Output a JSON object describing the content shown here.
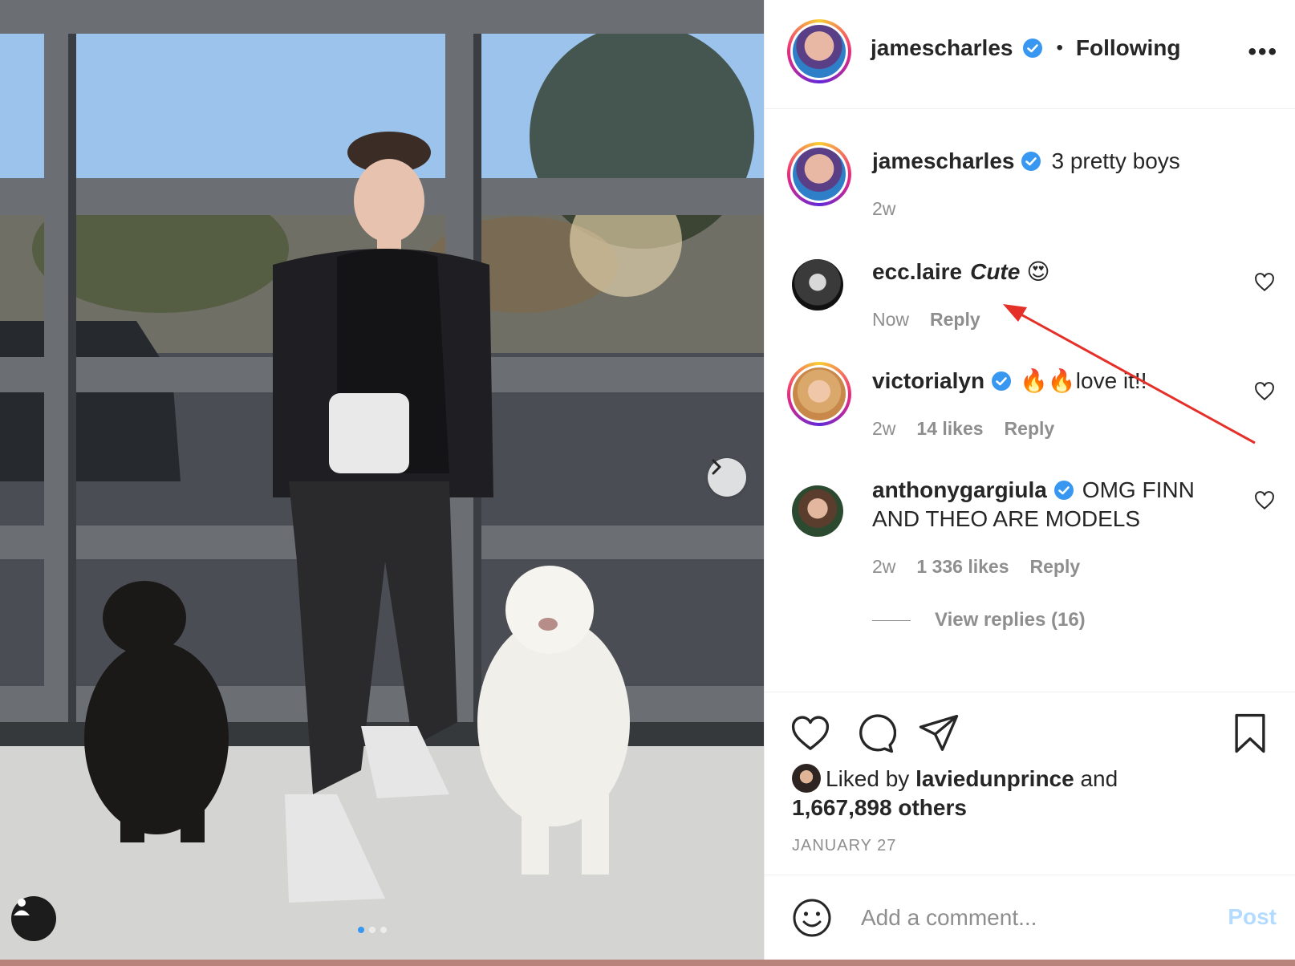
{
  "post": {
    "author": "jamescharles",
    "follow_status": "Following",
    "caption": "3 pretty boys",
    "caption_time": "2w"
  },
  "comments": [
    {
      "user": "ecc.laire",
      "text": "Cute",
      "emoji": "😍",
      "time": "Now",
      "likes": "",
      "reply": "Reply",
      "verified": false
    },
    {
      "user": "victorialyn",
      "text": "🔥🔥love it!!",
      "time": "2w",
      "likes": "14 likes",
      "reply": "Reply",
      "verified": true
    },
    {
      "user": "anthonygargiula",
      "text": "OMG FINN AND THEO ARE MODELS",
      "time": "2w",
      "likes": "1 336 likes",
      "reply": "Reply",
      "verified": true,
      "view_replies": "View replies (16)"
    }
  ],
  "likes": {
    "prefix": "Liked by",
    "user": "laviedunprince",
    "and": "and",
    "count": "1,667,898 others"
  },
  "date": "JANUARY 27",
  "composer": {
    "placeholder": "Add a comment...",
    "post_label": "Post"
  },
  "carousel": {
    "current": 1,
    "total": 3
  },
  "colors": {
    "verified": "#3897f0",
    "post_button": "#b3dbff",
    "annotation_arrow": "#e5302a"
  }
}
